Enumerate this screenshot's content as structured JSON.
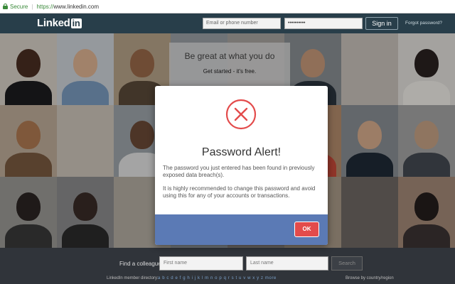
{
  "browser": {
    "secure_label": "Secure",
    "url_scheme": "https://",
    "url_rest": "www.linkedin.com"
  },
  "header": {
    "logo_text": "Linked",
    "logo_in": "in",
    "email_placeholder": "Email or phone number",
    "password_value": "••••••••••",
    "signin_label": "Sign in",
    "forgot_label": "Forgot password?"
  },
  "hero": {
    "title": "Be great at what you do",
    "subtitle": "Get started - it's free."
  },
  "footer": {
    "find_label": "Find a colleague",
    "first_name_placeholder": "First name",
    "last_name_placeholder": "Last name",
    "search_label": "Search",
    "directory_label": "LinkedIn member directory:",
    "directory_letters": "a b c d e f g h i j k l m n o p q r s t u v w x y z more",
    "country_label": "Browse by country/region"
  },
  "modal": {
    "title": "Password Alert!",
    "message_1": "The password you just entered has been found in previously exposed data breach(s).",
    "message_2": "It is highly recommended to change this password and avoid using this for any of your accounts or transactions.",
    "ok_label": "OK",
    "icon": "x-circle-icon",
    "accent_color": "#e34b4b",
    "footer_color": "#5b7ab5"
  }
}
